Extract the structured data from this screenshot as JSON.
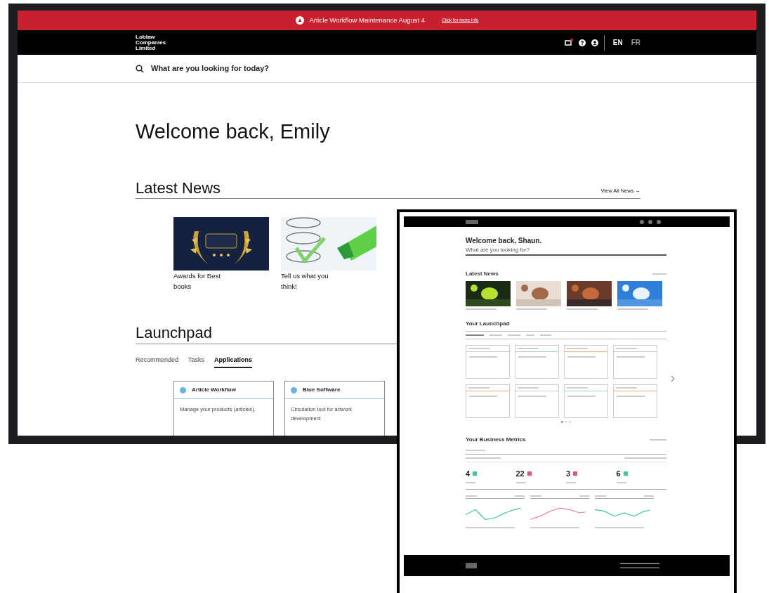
{
  "banner": {
    "text": "Article Workflow Maintenance August 4",
    "link": "Click for more info"
  },
  "navbar": {
    "logo": "Loblaw Companies Limited",
    "has_notification": true,
    "languages": [
      {
        "label": "EN",
        "selected": true
      },
      {
        "label": "FR",
        "selected": false
      }
    ]
  },
  "search": {
    "placeholder": "What are you looking for today?"
  },
  "welcome": "Welcome back, Emily",
  "latest_news": {
    "title": "Latest News",
    "view_all": "View All News →",
    "items": [
      {
        "caption": "Awards for Best books",
        "kind": "picture"
      },
      {
        "caption": "Tell us what you think!",
        "kind": "picture"
      }
    ]
  },
  "launchpad": {
    "title": "Launchpad",
    "tabs": [
      {
        "label": "Recommended",
        "selected": false
      },
      {
        "label": "Tasks",
        "selected": false
      },
      {
        "label": "Applications",
        "selected": true
      }
    ],
    "apps": [
      {
        "name": "Article Workflow",
        "description": "Manage your products (articles)."
      },
      {
        "name": "Blue Software",
        "description": "Circulation tool for artwork development"
      }
    ]
  },
  "mockup": {
    "welcome": "Welcome back, Shaun.",
    "search_placeholder": "What are you looking for?",
    "news_title": "Latest News",
    "launchpad_title": "Your Launchpad",
    "metrics_title": "Your Business Metrics",
    "metrics": [
      {
        "value": "4",
        "color": "#3ec99a"
      },
      {
        "value": "22",
        "color": "#e0566a"
      },
      {
        "value": "3",
        "color": "#e0566a"
      },
      {
        "value": "6",
        "color": "#3ec99a"
      }
    ]
  }
}
